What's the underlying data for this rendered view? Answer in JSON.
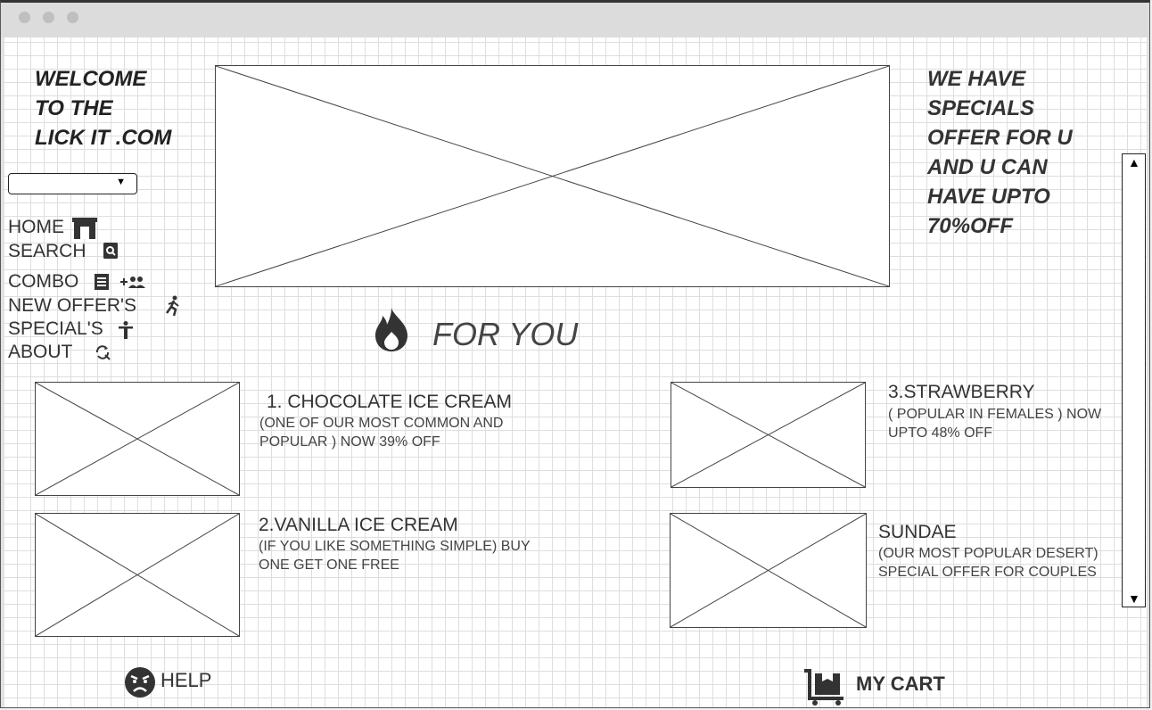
{
  "header": {
    "welcome": "WELCOME\nTO THE\nLICK IT .COM",
    "promo": "WE HAVE\nSPECIALS\nOFFER FOR U\nAND U CAN\nHAVE UPTO\n70%OFF"
  },
  "dropdown": {
    "value": ""
  },
  "nav": {
    "home": "HOME",
    "search": "SEARCH",
    "combo": "COMBO",
    "new_offers": "NEW OFFER'S",
    "specials": "SPECIAL'S",
    "about": "ABOUT"
  },
  "section": {
    "title": "FOR YOU"
  },
  "products": [
    {
      "title": "1. CHOCOLATE ICE CREAM",
      "description": "(ONE OF OUR MOST COMMON AND POPULAR ) NOW 39% OFF"
    },
    {
      "title": "2.VANILLA ICE CREAM",
      "description": "(IF YOU LIKE SOMETHING SIMPLE) BUY ONE GET ONE FREE"
    },
    {
      "title": "3.STRAWBERRY",
      "description": "( POPULAR IN FEMALES ) NOW UPTO 48% OFF"
    },
    {
      "title": "SUNDAE",
      "description": "(OUR MOST POPULAR DESERT) SPECIAL OFFER FOR COUPLES"
    }
  ],
  "footer": {
    "help": "HELP",
    "cart": "MY CART"
  },
  "icons": {
    "home": "home-icon",
    "search": "search-icon",
    "combo": "receipt-icon",
    "combo_extra": "add-group-icon",
    "new_offers": "runner-icon",
    "specials": "person-icon",
    "about": "refresh-search-icon",
    "for_you": "fire-icon",
    "help": "angry-face-icon",
    "cart": "cart-icon"
  }
}
